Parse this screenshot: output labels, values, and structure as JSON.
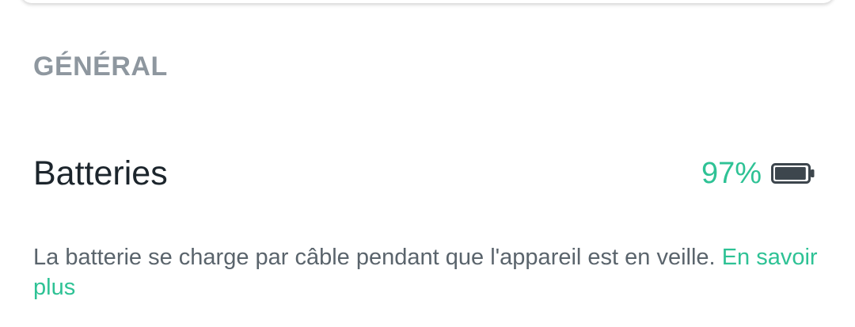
{
  "section": {
    "header": "GÉNÉRAL"
  },
  "battery": {
    "title": "Batteries",
    "percent": "97%",
    "level": 0.97,
    "icon": "battery-full-icon"
  },
  "description": {
    "text": "La batterie se charge par câble pendant que l'appareil est en veille. ",
    "link_label": "En savoir plus"
  },
  "colors": {
    "accent": "#2ec295",
    "header_text": "#8e979f",
    "title_text": "#1c252c",
    "body_text": "#5a646c",
    "battery_icon": "#3d464d"
  }
}
